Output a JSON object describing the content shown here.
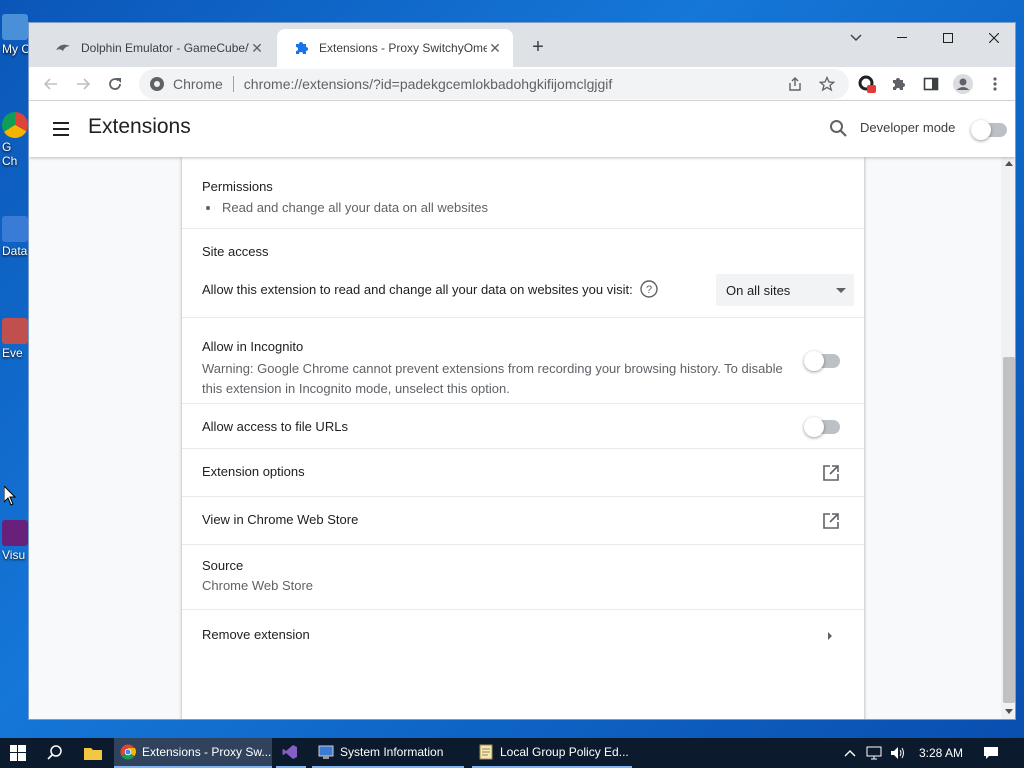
{
  "desktop": {
    "icons": [
      {
        "label": "My C"
      },
      {
        "label": "G\nCh"
      },
      {
        "label": "Data"
      },
      {
        "label": "Eve"
      },
      {
        "label": "Visu"
      }
    ]
  },
  "tabs": [
    {
      "title": "Dolphin Emulator - GameCube/Wii",
      "close": "✕"
    },
    {
      "title": "Extensions - Proxy SwitchyOmega",
      "close": "✕"
    }
  ],
  "new_tab": "+",
  "window_controls": {
    "minimize": "—",
    "maximize": "☐",
    "close": "✕",
    "tab_search": "⌄"
  },
  "omnibox": {
    "site_name": "Chrome",
    "url": "chrome://extensions/?id=padekgcemlokbadohgkifijomclgjgif"
  },
  "header": {
    "title": "Extensions",
    "developer_mode_label": "Developer mode",
    "developer_mode_on": false
  },
  "details": {
    "permissions_label": "Permissions",
    "permissions": [
      "Read and change all your data on all websites"
    ],
    "site_access_label": "Site access",
    "site_access_prompt": "Allow this extension to read and change all your data on websites you visit:",
    "site_access_value": "On all sites",
    "incognito_label": "Allow in Incognito",
    "incognito_warning": "Warning: Google Chrome cannot prevent extensions from recording your browsing history. To disable this extension in Incognito mode, unselect this option.",
    "incognito_on": false,
    "file_urls_label": "Allow access to file URLs",
    "file_urls_on": false,
    "extension_options_label": "Extension options",
    "web_store_label": "View in Chrome Web Store",
    "source_label": "Source",
    "source_value": "Chrome Web Store",
    "remove_label": "Remove extension"
  },
  "taskbar": {
    "apps": [
      {
        "label": "Extensions - Proxy Sw..."
      },
      {
        "label": ""
      },
      {
        "label": "System Information"
      },
      {
        "label": "Local Group Policy Ed..."
      }
    ],
    "time": "3:28 AM"
  },
  "colors": {
    "accent": "#1a73e8",
    "desktop": "#1577d8",
    "taskbar": "#0c1a2e"
  }
}
